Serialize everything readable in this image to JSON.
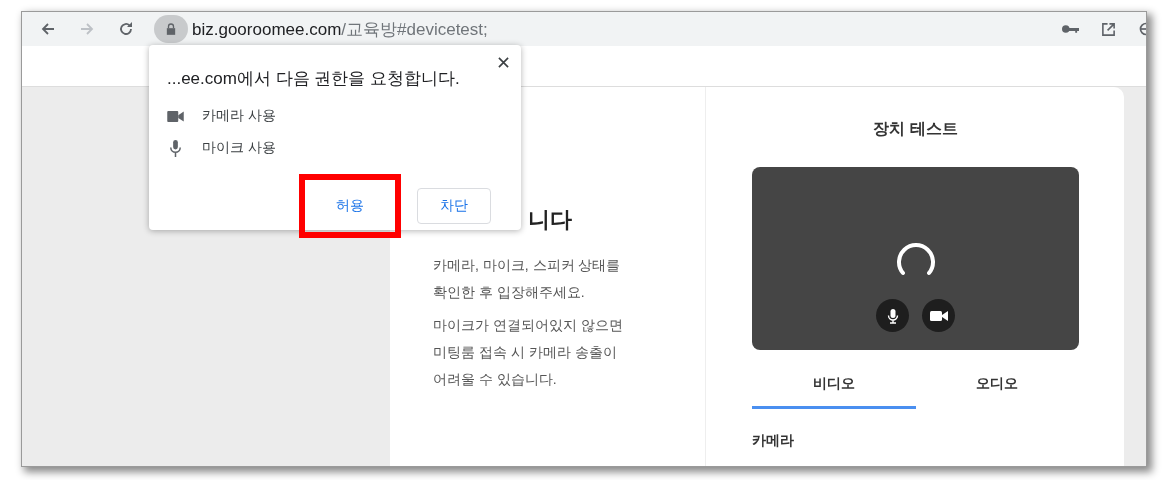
{
  "browser": {
    "url_host": "biz.gooroomee.com",
    "url_path": "/교육방#devicetest;"
  },
  "permission_popup": {
    "title": "...ee.com에서 다음 권한을 요청합니다.",
    "permissions": [
      {
        "kind": "camera",
        "label": "카메라 사용"
      },
      {
        "kind": "mic",
        "label": "마이크 사용"
      }
    ],
    "buttons": [
      {
        "label": "허용",
        "highlighted": true
      },
      {
        "label": "차단",
        "highlighted": false
      }
    ]
  },
  "intro": {
    "heading": "니다",
    "paragraphs": [
      [
        "카메라, 마이크, 스피커 상태를",
        "확인한 후 입장해주세요."
      ],
      [
        "마이크가 연결되어있지 않으면",
        "미팅룸 접속 시 카메라 송출이",
        "어려울 수 있습니다."
      ]
    ]
  },
  "device_test": {
    "title": "장치 테스트",
    "tabs": [
      {
        "label": "비디오",
        "selected": true
      },
      {
        "label": "오디오",
        "selected": false
      }
    ],
    "section_label": "카메라"
  }
}
